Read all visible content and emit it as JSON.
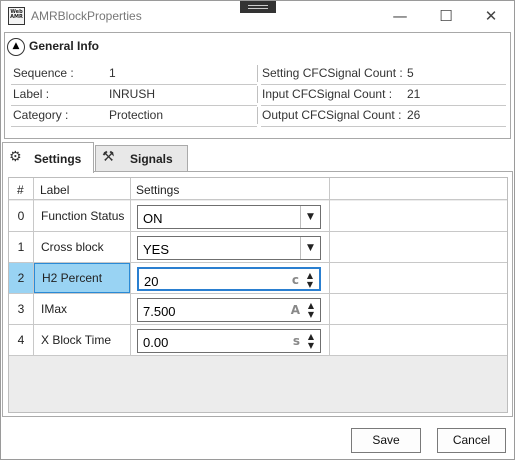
{
  "window": {
    "title": "AMRBlockProperties",
    "app_icon_text": "Web AMR"
  },
  "general_info": {
    "title": "General Info",
    "rows": [
      {
        "left_label": "Sequence :",
        "left_value": "1",
        "right_label": "Setting CFCSignal Count :",
        "right_value": "5"
      },
      {
        "left_label": "Label :",
        "left_value": "INRUSH",
        "right_label": "Input CFCSignal Count :",
        "right_value": "21"
      },
      {
        "left_label": "Category :",
        "left_value": "Protection",
        "right_label": "Output CFCSignal Count :",
        "right_value": "26"
      }
    ]
  },
  "tabs": [
    {
      "label": "Settings",
      "icon": "gear-icon",
      "active": true
    },
    {
      "label": "Signals",
      "icon": "tools-icon",
      "active": false
    }
  ],
  "grid": {
    "headers": [
      "#",
      "Label",
      "Settings"
    ],
    "rows": [
      {
        "num": "0",
        "label": "Function Status",
        "value": "ON",
        "editor": "dropdown",
        "unit": ""
      },
      {
        "num": "1",
        "label": "Cross block",
        "value": "YES",
        "editor": "dropdown",
        "unit": ""
      },
      {
        "num": "2",
        "label": "H2 Percent",
        "value": "20",
        "editor": "spinner",
        "unit": "c"
      },
      {
        "num": "3",
        "label": "IMax",
        "value": "7.500",
        "editor": "spinner",
        "unit": "A"
      },
      {
        "num": "4",
        "label": "X Block Time",
        "value": "0.00",
        "editor": "spinner",
        "unit": "s"
      }
    ],
    "selected_row": 2
  },
  "buttons": {
    "save": "Save",
    "cancel": "Cancel"
  }
}
